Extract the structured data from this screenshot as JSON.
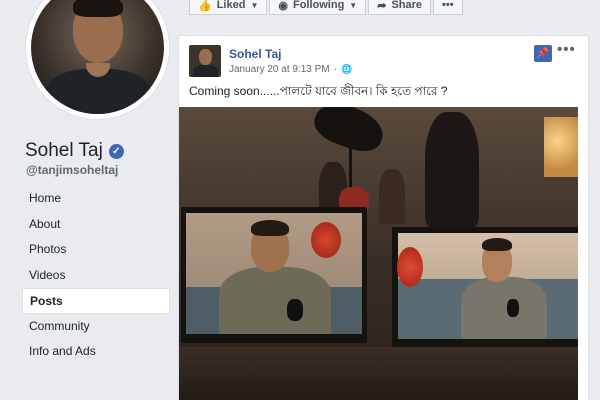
{
  "profile": {
    "name": "Sohel Taj",
    "handle": "@tanjimsoheltaj",
    "verified_icon": "verified-check-icon"
  },
  "nav": {
    "items": [
      {
        "label": "Home",
        "active": false
      },
      {
        "label": "About",
        "active": false
      },
      {
        "label": "Photos",
        "active": false
      },
      {
        "label": "Videos",
        "active": false
      },
      {
        "label": "Posts",
        "active": true
      },
      {
        "label": "Community",
        "active": false
      },
      {
        "label": "Info and Ads",
        "active": false
      }
    ]
  },
  "actions": {
    "liked_label": "Liked",
    "following_label": "Following",
    "share_label": "Share",
    "more_label": "•••"
  },
  "post": {
    "author": "Sohel Taj",
    "timestamp": "January 20 at 9:13 PM",
    "meta_separator": "·",
    "text": "Coming soon......পালটে যাবে জীবন। কি হতে পারে ?",
    "more_label": "•••"
  },
  "colors": {
    "accent": "#4267b2",
    "link": "#385898",
    "page_bg": "#e9ebee"
  }
}
